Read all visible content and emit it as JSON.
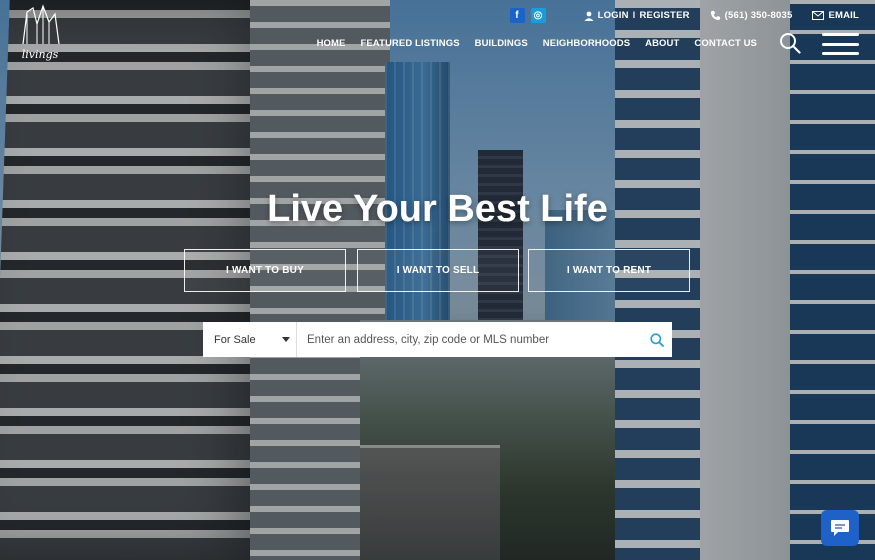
{
  "brand": {
    "logo_text": "livings"
  },
  "topbar": {
    "social": [
      {
        "icon": "facebook-icon",
        "label": "f"
      },
      {
        "icon": "instagram-icon",
        "label": "◎"
      }
    ],
    "login": "LOGIN",
    "register": "REGISTER",
    "separator": "I",
    "phone": "(561) 350-8035",
    "email": "EMAIL"
  },
  "nav": {
    "items": [
      "HOME",
      "FEATURED LISTINGS",
      "BUILDINGS",
      "NEIGHBORHOODS",
      "ABOUT",
      "CONTACT US"
    ]
  },
  "hero": {
    "headline": "Live Your Best Life",
    "buttons": [
      "I WANT TO BUY",
      "I WANT TO SELL",
      "I WANT TO RENT"
    ]
  },
  "search": {
    "selected": "For Sale",
    "placeholder": "Enter an address, city, zip code or MLS number"
  },
  "colors": {
    "facebook": "#1a64c9",
    "instagram": "#1a9cd8",
    "chat": "#1e62c9",
    "search_icon": "#1ea0d8"
  }
}
